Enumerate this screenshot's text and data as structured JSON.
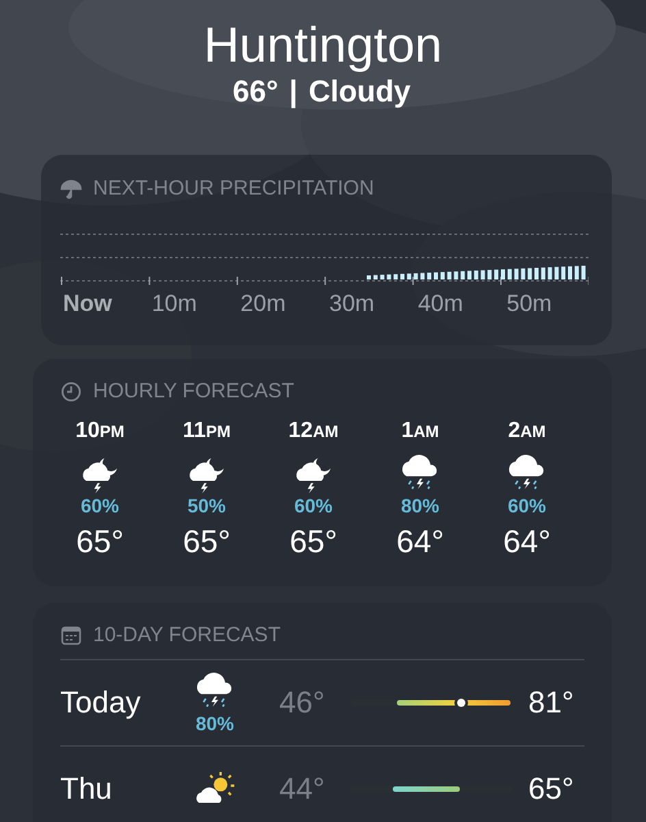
{
  "location": {
    "city": "Huntington",
    "temperature": "66°",
    "separator": "|",
    "condition": "Cloudy"
  },
  "precipitation": {
    "title": "NEXT-HOUR PRECIPITATION",
    "ticks": [
      "Now",
      "10m",
      "20m",
      "30m",
      "40m",
      "50m"
    ]
  },
  "hourly": {
    "title": "HOURLY FORECAST",
    "hours": [
      {
        "hour": "10",
        "period": "PM",
        "kind": "storm-night",
        "chance": "60%",
        "temp": "65°"
      },
      {
        "hour": "11",
        "period": "PM",
        "kind": "storm-night",
        "chance": "50%",
        "temp": "65°"
      },
      {
        "hour": "12",
        "period": "AM",
        "kind": "storm-night",
        "chance": "60%",
        "temp": "65°"
      },
      {
        "hour": "1",
        "period": "AM",
        "kind": "thunderstorm",
        "chance": "80%",
        "temp": "64°"
      },
      {
        "hour": "2",
        "period": "AM",
        "kind": "thunderstorm",
        "chance": "60%",
        "temp": "64°"
      }
    ]
  },
  "daily": {
    "title": "10-DAY FORECAST",
    "days": [
      {
        "day": "Today",
        "kind": "thunderstorm",
        "chance": "80%",
        "low": "46°",
        "high": "81°",
        "current": {
          "level": 0.69
        }
      },
      {
        "day": "Thu",
        "kind": "partly-sunny",
        "low": "44°",
        "high": "65°"
      }
    ]
  }
}
